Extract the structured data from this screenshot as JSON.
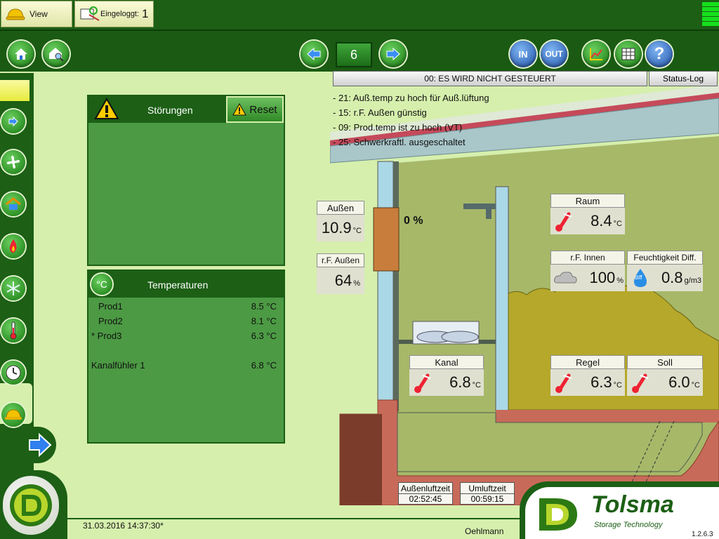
{
  "topbar": {
    "view_label": "View",
    "login_label": "Eingeloggt:",
    "login_level": "1"
  },
  "nav": {
    "page_number": "6",
    "in_label": "IN",
    "out_label": "OUT",
    "help_label": "?"
  },
  "alarms": {
    "title": "Störungen",
    "reset_label": "Reset"
  },
  "temperatures": {
    "title": "Temperaturen",
    "unit_symbol": "°C",
    "rows": [
      {
        "name": "Prod1",
        "value": "8.5 °C"
      },
      {
        "name": "Prod2",
        "value": "8.1 °C"
      },
      {
        "name": "* Prod3",
        "value": "6.3 °C"
      },
      {
        "name": "Kanalfühler 1",
        "value": "6.8 °C"
      }
    ]
  },
  "status": {
    "main": "00: ES WIRD NICHT GESTEUERT",
    "log_label": "Status-Log",
    "messages": [
      "- 21: Auß.temp zu hoch für Auß.lüftung",
      "- 15: r.F. Außen günstig",
      "- 09: Prod.temp ist zu hoch (VT)",
      "- 25: Schwerkraftl. ausgeschaltet"
    ]
  },
  "values": {
    "aussen": {
      "label": "Außen",
      "value": "10.9",
      "unit": "°C"
    },
    "rf_aussen": {
      "label": "r.F. Außen",
      "value": "64",
      "unit": "%"
    },
    "damper": {
      "value": "0 %"
    },
    "raum": {
      "label": "Raum",
      "value": "8.4",
      "unit": "°C"
    },
    "rf_innen": {
      "label": "r.F. Innen",
      "value": "100",
      "unit": "%"
    },
    "feuchte_diff": {
      "label": "Feuchtigkeit Diff.",
      "value": "0.8",
      "unit": "g/m3",
      "icon_text": "diff"
    },
    "kanal": {
      "label": "Kanal",
      "value": "6.8",
      "unit": "°C"
    },
    "regel": {
      "label": "Regel",
      "value": "6.3",
      "unit": "°C"
    },
    "soll": {
      "label": "Soll",
      "value": "6.0",
      "unit": "°C"
    }
  },
  "timers": {
    "aussenluft": {
      "label": "Außenluftzeit",
      "value": "02:52:45"
    },
    "umluft": {
      "label": "Umluftzeit",
      "value": "00:59:15"
    }
  },
  "footer": {
    "datetime": "31.03.2016 14:37:30*",
    "user": "Oehlmann",
    "version": "1.2.6.3"
  },
  "brand": {
    "name": "Tolsma",
    "tagline": "Storage Technology",
    "color": "#1c5f15"
  },
  "colors": {
    "frame_green": "#1c5f15",
    "panel_green": "#4c9a44",
    "background": "#d6efad",
    "wall_blue": "#aad8e6",
    "brick": "#c86a5a"
  }
}
